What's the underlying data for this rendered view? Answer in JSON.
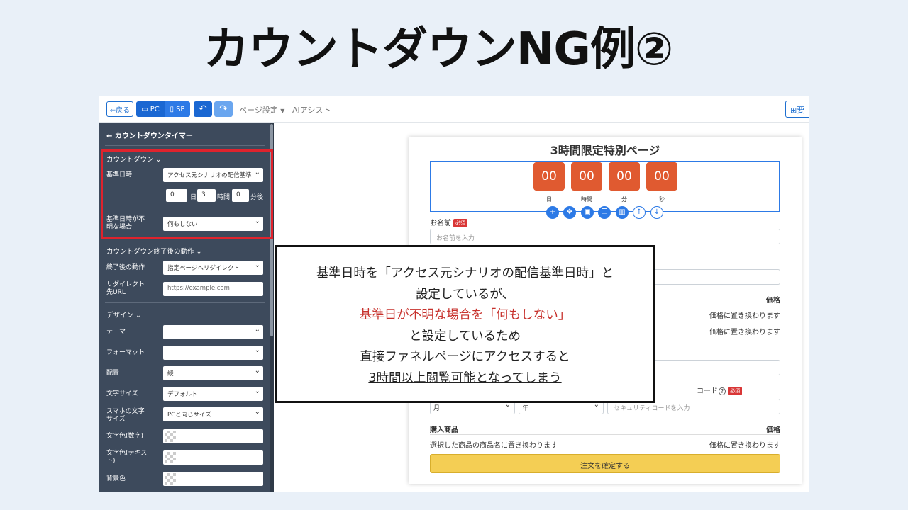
{
  "slide_title": "カウントダウンNG例②",
  "toolbar": {
    "back": "⇐戻る",
    "pc": "PC",
    "sp": "SP",
    "undo": "↶",
    "redo": "↷",
    "page_settings": "ページ設定",
    "ai_assist": "AIアシスト",
    "right_btn": "要"
  },
  "sidebar": {
    "header": "←  カウントダウンタイマー",
    "countdown_section": "カウントダウン  ⌄",
    "base_datetime_label": "基準日時",
    "base_datetime_value": "アクセス元シナリオの配信基準",
    "offset_days": "0",
    "days_unit": "日",
    "offset_hours": "3",
    "hours_unit": "時間",
    "offset_minutes": "0",
    "minutes_unit": "分後",
    "unknown_label": "基準日時が不明な場合",
    "unknown_value": "何もしない",
    "after_section": "カウントダウン終了後の動作  ⌄",
    "after_label": "終了後の動作",
    "after_value": "指定ページへリダイレクト",
    "redirect_label": "リダイレクト先URL",
    "redirect_placeholder": "https://example.com",
    "design_section": "デザイン  ⌄",
    "theme_label": "テーマ",
    "theme_value": "",
    "format_label": "フォーマット",
    "format_value": "",
    "layout_label": "配置",
    "layout_value": "縦",
    "fontsize_label": "文字サイズ",
    "fontsize_value": "デフォルト",
    "sp_fontsize_label": "スマホの文字サイズ",
    "sp_fontsize_value": "PCと同じサイズ",
    "digit_color_label": "文字色(数字)",
    "text_color_label": "文字色(テキスト)",
    "bg_color_label": "背景色"
  },
  "form": {
    "title": "3時間限定特別ページ",
    "timer": {
      "days": "00",
      "hours": "00",
      "minutes": "00",
      "seconds": "00",
      "days_label": "日",
      "hours_label": "時間",
      "minutes_label": "分",
      "seconds_label": "秒"
    },
    "name_label": "お名前",
    "required": "必須",
    "name_placeholder": "お名前を入力",
    "price_header": "価格",
    "price_replace_1": "価格に置き換わります",
    "price_replace_2": "価格に置き換わります",
    "security_code_label": "コード",
    "help": "?",
    "month": "月",
    "year": "年",
    "security_placeholder": "セキュリティコードを入力",
    "purchase_label": "購入商品",
    "price_label": "価格",
    "product_placeholder": "選択した商品の商品名に置き換わります",
    "price_replace_3": "価格に置き換わります",
    "submit": "注文を確定する"
  },
  "note": {
    "line1": "基準日時を「アクセス元シナリオの配信基準日時」と",
    "line2": "設定しているが、",
    "line3": "基準日が不明な場合を「何もしない」",
    "line4": "と設定しているため",
    "line5": "直接ファネルページにアクセスすると",
    "line6": "3時間以上閲覧可能となってしまう"
  },
  "colors": {
    "accent": "#1a67d2",
    "timer": "#e05a30",
    "highlight": "#e0232d",
    "submit": "#f4ce54"
  }
}
